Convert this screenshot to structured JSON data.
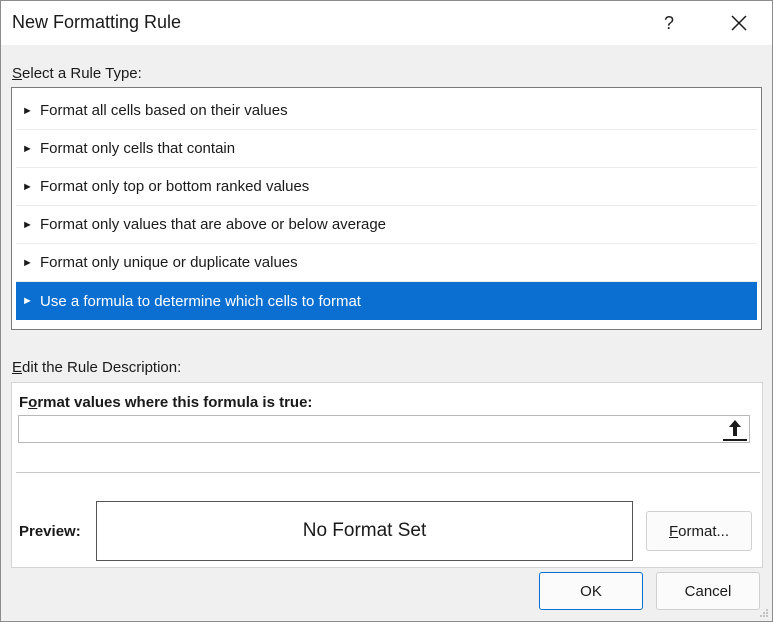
{
  "dialog": {
    "title": "New Formatting Rule",
    "help_label": "?",
    "close_icon": "close-icon"
  },
  "rule_type": {
    "label_accel": "S",
    "label_rest": "elect a Rule Type:",
    "arrow": "►",
    "items": [
      {
        "label": "Format all cells based on their values",
        "selected": false
      },
      {
        "label": "Format only cells that contain",
        "selected": false
      },
      {
        "label": "Format only top or bottom ranked values",
        "selected": false
      },
      {
        "label": "Format only values that are above or below average",
        "selected": false
      },
      {
        "label": "Format only unique or duplicate values",
        "selected": false
      },
      {
        "label": "Use a formula to determine which cells to format",
        "selected": true
      }
    ]
  },
  "description": {
    "label_accel": "E",
    "label_rest": "dit the Rule Description:",
    "formula_label_pre": "F",
    "formula_label_accel": "o",
    "formula_label_rest": "rmat values where this formula is true:",
    "formula_value": "",
    "preview_label": "Preview:",
    "preview_text": "No Format Set",
    "format_button_accel": "F",
    "format_button_rest": "ormat..."
  },
  "footer": {
    "ok_label": "OK",
    "cancel_label": "Cancel"
  },
  "colors": {
    "selection": "#0a6fd1",
    "default_button_border": "#0a6fd1"
  }
}
